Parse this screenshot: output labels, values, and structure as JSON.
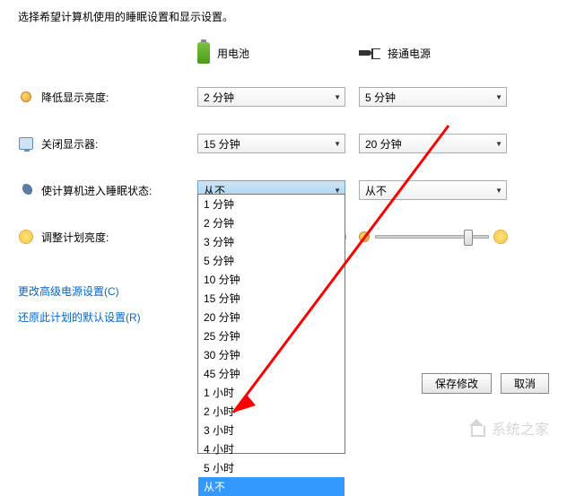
{
  "instruction": "选择希望计算机使用的睡眠设置和显示设置。",
  "columns": {
    "battery": "用电池",
    "plugged": "接通电源"
  },
  "rows": {
    "dim": {
      "label": "降低显示亮度:",
      "battery": "2 分钟",
      "plugged": "5 分钟"
    },
    "display_off": {
      "label": "关闭显示器:",
      "battery": "15 分钟",
      "plugged": "20 分钟"
    },
    "sleep": {
      "label": "使计算机进入睡眠状态:",
      "battery": "从不",
      "plugged": "从不"
    },
    "brightness": {
      "label": "调整计划亮度:"
    }
  },
  "dropdown_options": [
    "1 分钟",
    "2 分钟",
    "3 分钟",
    "5 分钟",
    "10 分钟",
    "15 分钟",
    "20 分钟",
    "25 分钟",
    "30 分钟",
    "45 分钟",
    "1 小时",
    "2 小时",
    "3 小时",
    "4 小时",
    "5 小时",
    "从不"
  ],
  "dropdown_highlighted": "从不",
  "links": {
    "advanced": "更改高级电源设置(C)",
    "restore": "还原此计划的默认设置(R)"
  },
  "buttons": {
    "save": "保存修改",
    "cancel": "取消"
  },
  "watermark": "系统之家"
}
